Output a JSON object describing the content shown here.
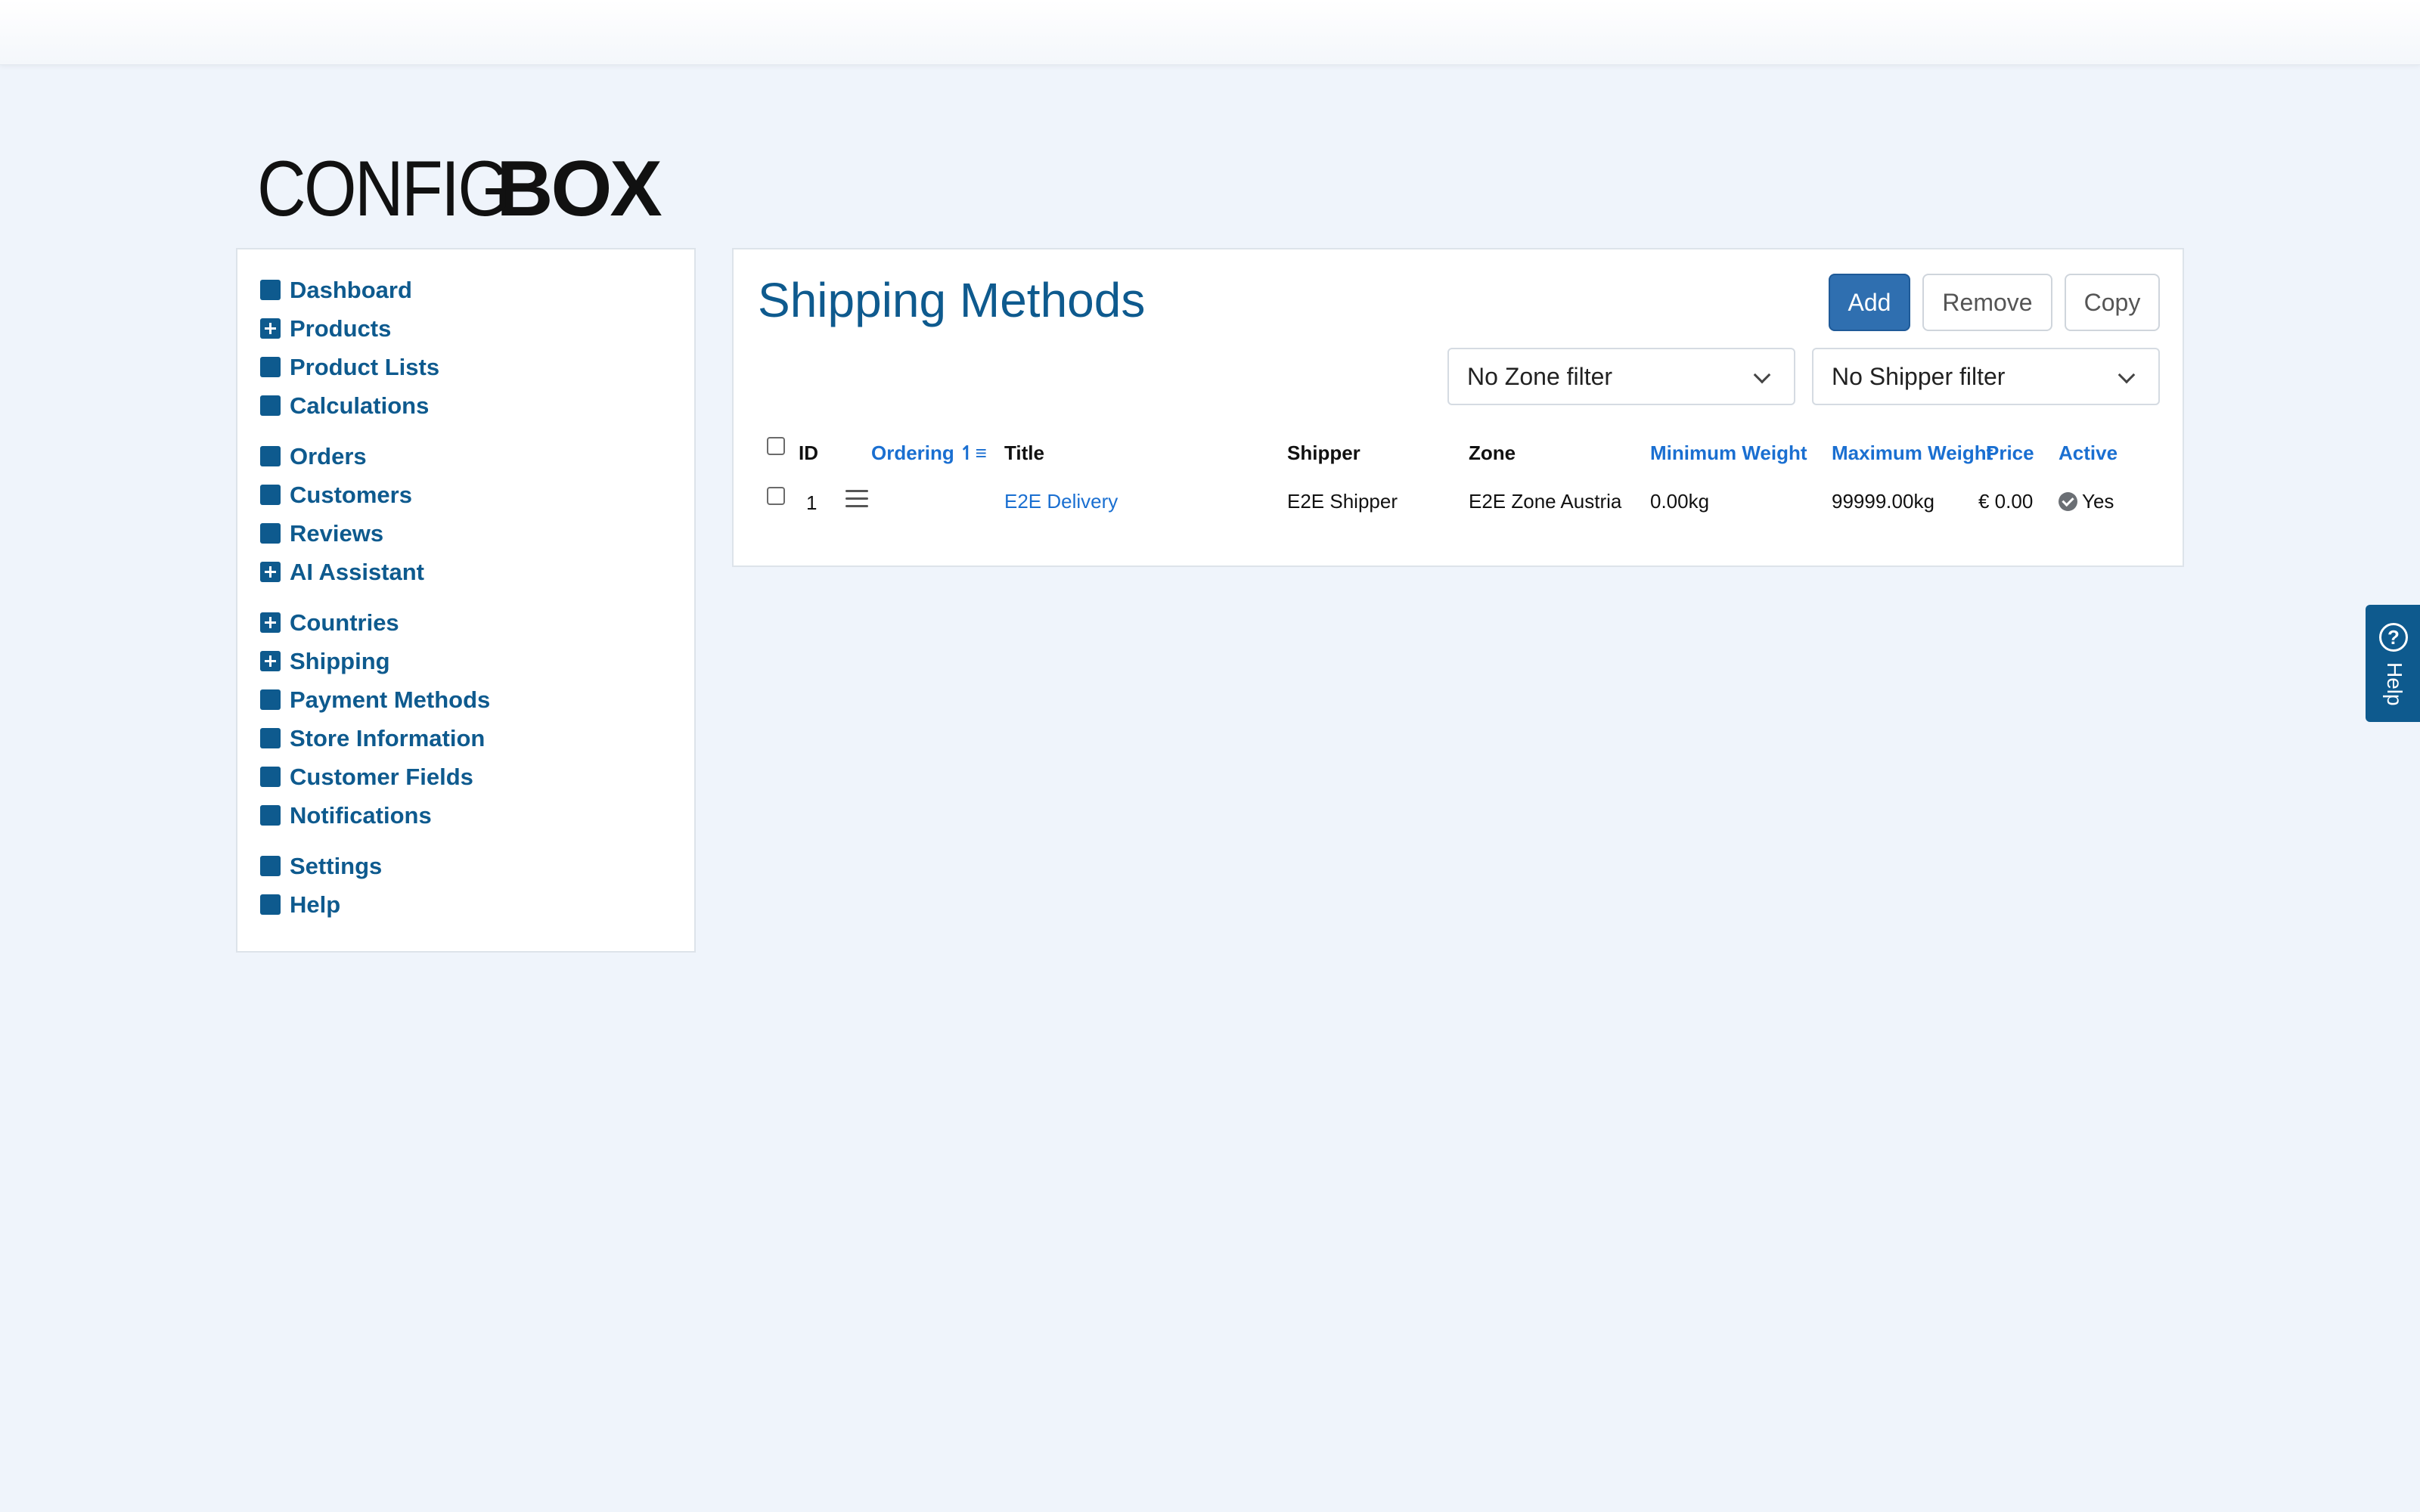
{
  "logo": {
    "light": "CONFIG",
    "bold": "BOX"
  },
  "sidebar": {
    "groups": [
      [
        {
          "label": "Dashboard",
          "icon": "square-icon"
        },
        {
          "label": "Products",
          "icon": "plus-square-icon"
        },
        {
          "label": "Product Lists",
          "icon": "square-icon"
        },
        {
          "label": "Calculations",
          "icon": "square-icon"
        }
      ],
      [
        {
          "label": "Orders",
          "icon": "square-icon"
        },
        {
          "label": "Customers",
          "icon": "square-icon"
        },
        {
          "label": "Reviews",
          "icon": "square-icon"
        },
        {
          "label": "AI Assistant",
          "icon": "plus-square-icon"
        }
      ],
      [
        {
          "label": "Countries",
          "icon": "plus-square-icon"
        },
        {
          "label": "Shipping",
          "icon": "plus-square-icon"
        },
        {
          "label": "Payment Methods",
          "icon": "square-icon"
        },
        {
          "label": "Store Information",
          "icon": "square-icon"
        },
        {
          "label": "Customer Fields",
          "icon": "square-icon"
        },
        {
          "label": "Notifications",
          "icon": "square-icon"
        }
      ],
      [
        {
          "label": "Settings",
          "icon": "square-icon"
        },
        {
          "label": "Help",
          "icon": "square-icon"
        }
      ]
    ]
  },
  "main": {
    "title": "Shipping Methods",
    "buttons": {
      "add": "Add",
      "remove": "Remove",
      "copy": "Copy"
    },
    "filters": {
      "zone": "No Zone filter",
      "shipper": "No Shipper filter"
    },
    "table": {
      "headers": {
        "id": "ID",
        "ordering": "Ordering",
        "title": "Title",
        "shipper": "Shipper",
        "zone": "Zone",
        "min_weight": "Minimum Weight",
        "max_weight": "Maximum Weight",
        "price": "Price",
        "active": "Active"
      },
      "rows": [
        {
          "id": "1",
          "title": "E2E Delivery",
          "shipper": "E2E Shipper",
          "zone": "E2E Zone Austria",
          "min_weight": "0.00kg",
          "max_weight": "99999.00kg",
          "price": "€ 0.00",
          "active": "Yes"
        }
      ]
    }
  },
  "help_tab": {
    "label": "Help",
    "icon_text": "?"
  },
  "colors": {
    "brand": "#0e5a8e",
    "link": "#1a6fd1",
    "primary_button": "#2f6fb0",
    "background": "#eff4fb"
  }
}
